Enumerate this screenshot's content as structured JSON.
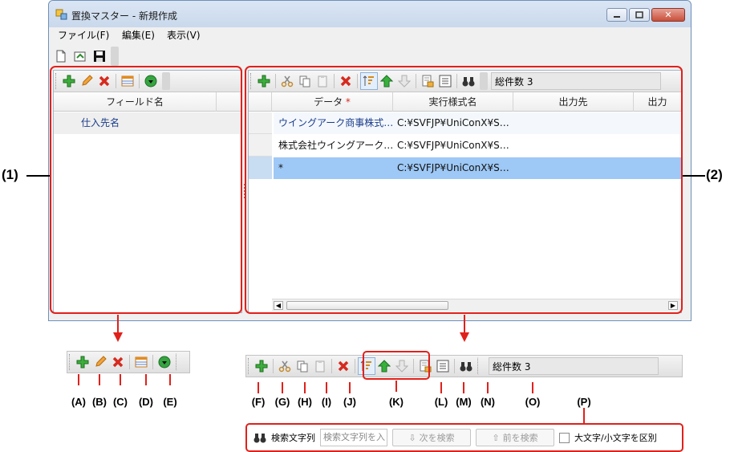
{
  "window": {
    "title": "置換マスター - 新規作成",
    "controls": [
      "minimize",
      "maximize",
      "close"
    ]
  },
  "menu": {
    "items": [
      "ファイル(F)",
      "編集(E)",
      "表示(V)"
    ]
  },
  "toolbar_top": {
    "icons": [
      "new-file-icon",
      "open-file-icon",
      "save-icon"
    ]
  },
  "left_panel": {
    "column_header": "フィールド名",
    "rows": [
      "仕入先名"
    ]
  },
  "right_panel": {
    "total_label": "総件数 3",
    "columns": [
      "データ",
      "実行様式名",
      "出力先",
      "出力"
    ],
    "required_mark": "*",
    "rows": [
      {
        "data": "ウイングアーク商事株式…",
        "form": "C:¥SVFJP¥UniConX¥S…"
      },
      {
        "data": "株式会社ウイングアーク…",
        "form": "C:¥SVFJP¥UniConX¥S…"
      },
      {
        "data": "*",
        "form": "C:¥SVFJP¥UniConX¥S…"
      }
    ]
  },
  "callouts": {
    "left": "(1)",
    "right": "(2)"
  },
  "left_toolbar_labels": [
    "(A)",
    "(B)",
    "(C)",
    "(D)",
    "(E)"
  ],
  "right_toolbar_labels": [
    "(F)",
    "(G)",
    "(H)",
    "(I)",
    "(J)",
    "(K)",
    "(L)",
    "(M)",
    "(N)",
    "(O)",
    "(P)"
  ],
  "search_bar": {
    "label": "検索文字列",
    "placeholder": "検索文字列を入",
    "next_button": "次を検索",
    "prev_button": "前を検索",
    "case_checkbox": "大文字/小文字を区別"
  },
  "colors": {
    "accent_red": "#e0211b",
    "selection": "#9ec8f5"
  }
}
